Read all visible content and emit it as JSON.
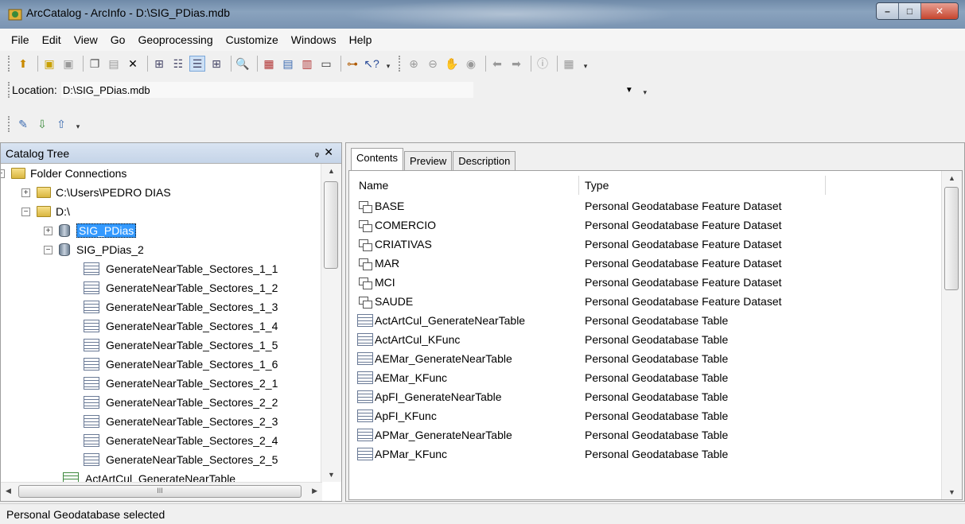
{
  "window": {
    "title": "ArcCatalog - ArcInfo - D:\\SIG_PDias.mdb",
    "minimize": "–",
    "maximize": "□",
    "close": "✕"
  },
  "menu": [
    "File",
    "Edit",
    "View",
    "Go",
    "Geoprocessing",
    "Customize",
    "Windows",
    "Help"
  ],
  "location": {
    "label": "Location:",
    "value": "D:\\SIG_PDias.mdb"
  },
  "catalog_tree": {
    "title": "Catalog Tree",
    "pin": "ᵩ",
    "close": "✕",
    "nodes": {
      "folder_connections": "Folder Connections",
      "users": "C:\\Users\\PEDRO DIAS",
      "d_drive": "D:\\",
      "sig_pdias": "SIG_PDias",
      "sig_pdias_2": "SIG_PDias_2",
      "tables": [
        "GenerateNearTable_Sectores_1_1",
        "GenerateNearTable_Sectores_1_2",
        "GenerateNearTable_Sectores_1_3",
        "GenerateNearTable_Sectores_1_4",
        "GenerateNearTable_Sectores_1_5",
        "GenerateNearTable_Sectores_1_6",
        "GenerateNearTable_Sectores_2_1",
        "GenerateNearTable_Sectores_2_2",
        "GenerateNearTable_Sectores_2_3",
        "GenerateNearTable_Sectores_2_4",
        "GenerateNearTable_Sectores_2_5"
      ],
      "last": "ActArtCul_GenerateNearTable"
    },
    "hscroll_grip": "III"
  },
  "tabs": [
    "Contents",
    "Preview",
    "Description"
  ],
  "contents": {
    "columns": [
      "Name",
      "Type"
    ],
    "rows": [
      {
        "name": "BASE",
        "type": "Personal Geodatabase Feature Dataset",
        "icon": "feature-dataset-icon"
      },
      {
        "name": "COMERCIO",
        "type": "Personal Geodatabase Feature Dataset",
        "icon": "feature-dataset-icon"
      },
      {
        "name": "CRIATIVAS",
        "type": "Personal Geodatabase Feature Dataset",
        "icon": "feature-dataset-icon"
      },
      {
        "name": "MAR",
        "type": "Personal Geodatabase Feature Dataset",
        "icon": "feature-dataset-icon"
      },
      {
        "name": "MCI",
        "type": "Personal Geodatabase Feature Dataset",
        "icon": "feature-dataset-icon"
      },
      {
        "name": "SAUDE",
        "type": "Personal Geodatabase Feature Dataset",
        "icon": "feature-dataset-icon"
      },
      {
        "name": "ActArtCul_GenerateNearTable",
        "type": "Personal Geodatabase Table",
        "icon": "table-icon"
      },
      {
        "name": "ActArtCul_KFunc",
        "type": "Personal Geodatabase Table",
        "icon": "table-icon"
      },
      {
        "name": "AEMar_GenerateNearTable",
        "type": "Personal Geodatabase Table",
        "icon": "table-icon"
      },
      {
        "name": "AEMar_KFunc",
        "type": "Personal Geodatabase Table",
        "icon": "table-icon"
      },
      {
        "name": "ApFI_GenerateNearTable",
        "type": "Personal Geodatabase Table",
        "icon": "table-icon"
      },
      {
        "name": "ApFI_KFunc",
        "type": "Personal Geodatabase Table",
        "icon": "table-icon"
      },
      {
        "name": "APMar_GenerateNearTable",
        "type": "Personal Geodatabase Table",
        "icon": "table-icon"
      },
      {
        "name": "APMar_KFunc",
        "type": "Personal Geodatabase Table",
        "icon": "table-icon"
      }
    ]
  },
  "status": "Personal Geodatabase selected",
  "colors": {
    "selection": "#3399ff",
    "panel_header": "#c5d4e8"
  }
}
